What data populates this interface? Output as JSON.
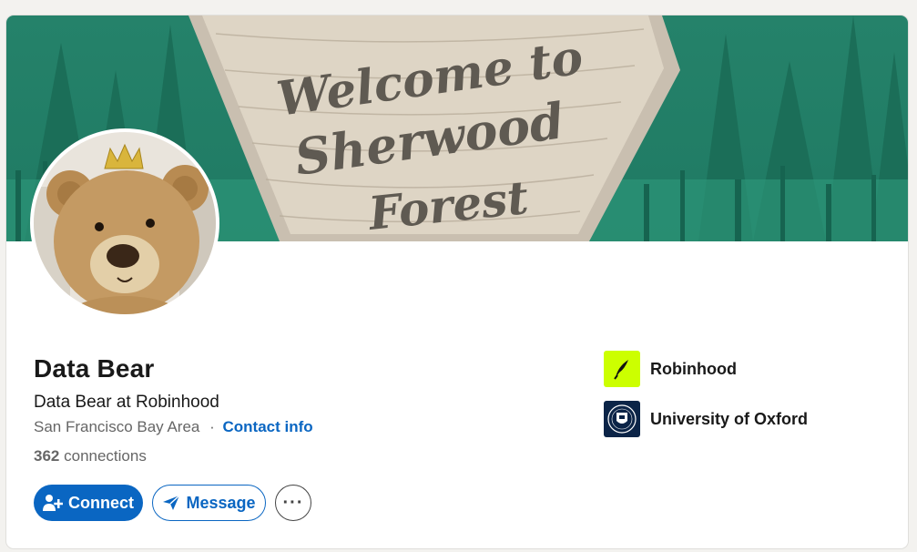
{
  "profile": {
    "name": "Data Bear",
    "headline": "Data Bear at Robinhood",
    "location": "San Francisco Bay Area",
    "separator": "·",
    "contact_info": "Contact info",
    "connections_count": "362",
    "connections_label": "connections"
  },
  "actions": {
    "connect_label": "Connect",
    "message_label": "Message",
    "more_label": "···"
  },
  "organizations": [
    {
      "name": "Robinhood",
      "logo_color": "#ccff00",
      "icon": "robinhood-feather-icon"
    },
    {
      "name": "University of Oxford",
      "logo_color": "#0b2447",
      "icon": "oxford-crest-icon"
    }
  ],
  "banner": {
    "sign_text_line1": "Welcome to",
    "sign_text_line2": "Sherwood",
    "sign_text_line3": "Forest",
    "background_color": "#2a8a6e"
  },
  "colors": {
    "accent": "#0a66c2",
    "text": "#191919",
    "muted": "#666666"
  }
}
